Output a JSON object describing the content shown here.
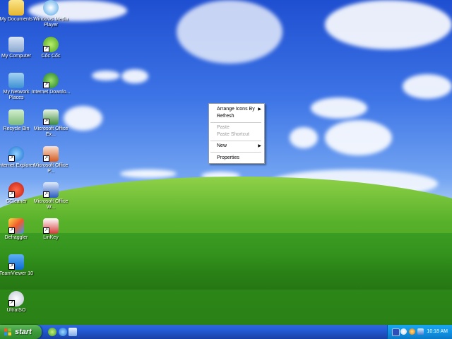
{
  "desktop": {
    "icons": [
      {
        "label": "My Documents"
      },
      {
        "label": "Windows Media Player"
      },
      {
        "label": "My Computer"
      },
      {
        "label": "Cốc Cốc"
      },
      {
        "label": "My Network Places"
      },
      {
        "label": "Internet Downlo..."
      },
      {
        "label": "Recycle Bin"
      },
      {
        "label": "Microsoft Office Ex..."
      },
      {
        "label": "Internet Explorer"
      },
      {
        "label": "Microsoft Office P..."
      },
      {
        "label": "CCleaner"
      },
      {
        "label": "Microsoft Office W..."
      },
      {
        "label": "Defraggler"
      },
      {
        "label": "LinKey"
      },
      {
        "label": "TeamViewer 10"
      },
      {
        "label": "UltraISO"
      }
    ]
  },
  "context_menu": {
    "items": [
      {
        "label": "Arrange Icons By"
      },
      {
        "label": "Refresh"
      },
      {
        "label": "Paste"
      },
      {
        "label": "Paste Shortcut"
      },
      {
        "label": "New"
      },
      {
        "label": "Properties"
      }
    ]
  },
  "taskbar": {
    "start_label": "start",
    "clock": "10:18 AM"
  }
}
